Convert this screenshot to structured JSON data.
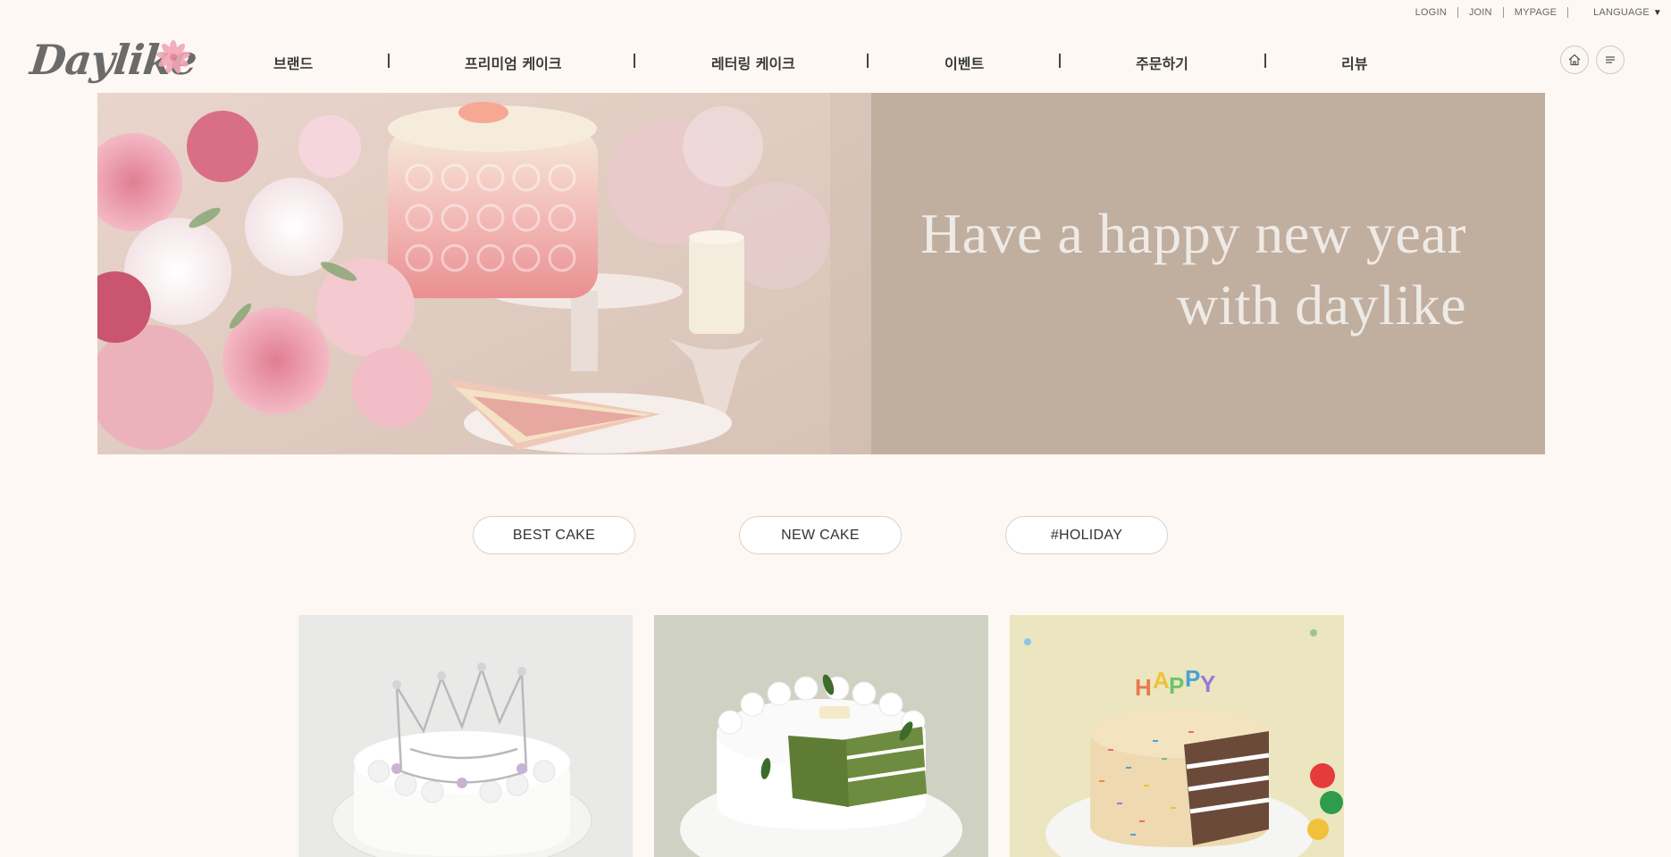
{
  "utility": {
    "login": "LOGIN",
    "join": "JOIN",
    "mypage": "MYPAGE",
    "language": "LANGUAGE"
  },
  "brand": {
    "logo_text": "Daylike"
  },
  "nav": {
    "items": [
      "브랜드",
      "프리미엄 케이크",
      "레터링 케이크",
      "이벤트",
      "주문하기",
      "리뷰"
    ]
  },
  "header_icons": [
    "home-icon",
    "menu-icon"
  ],
  "hero": {
    "line1": "Have a happy new year",
    "line2": "with daylike",
    "panel_color": "#c0ae9f"
  },
  "tabs": [
    "BEST CAKE",
    "NEW CAKE",
    "#HOLIDAY"
  ],
  "products": [
    {
      "image": "white cake with silver crown"
    },
    {
      "image": "white cake with green matcha layers"
    },
    {
      "image": "sprinkle cake with happy birthday topper"
    }
  ],
  "colors": {
    "page_bg": "#fdf8f4",
    "logo": "#6b6b6b",
    "accent_pink": "#f0a8b6"
  }
}
